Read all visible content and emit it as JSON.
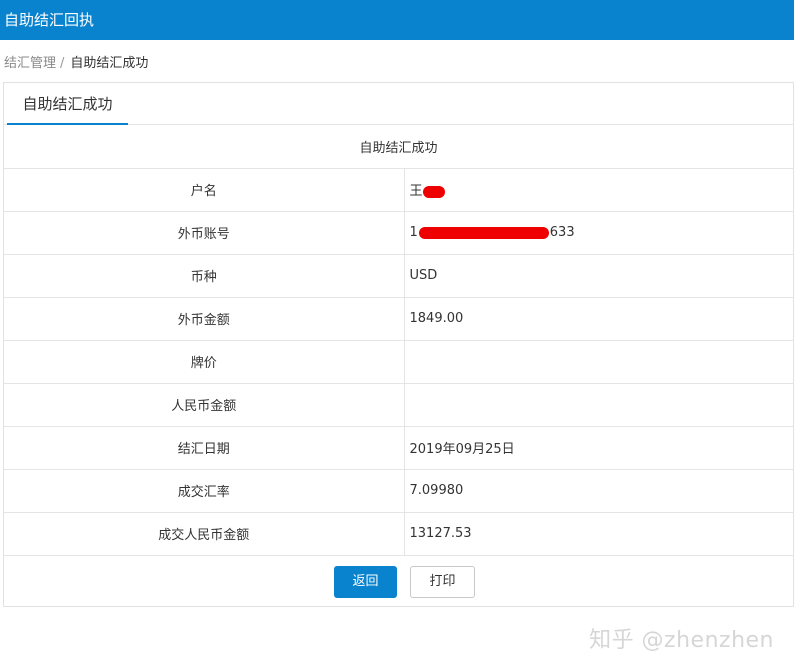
{
  "header": {
    "title": "自助结汇回执"
  },
  "breadcrumb": {
    "parent": "结汇管理",
    "separator": "/",
    "current": "自助结汇成功"
  },
  "tab": {
    "label": "自助结汇成功"
  },
  "table": {
    "caption": "自助结汇成功",
    "rows": [
      {
        "label": "户名",
        "value": "王"
      },
      {
        "label": "外币账号",
        "value_prefix": "1",
        "value_suffix": "633"
      },
      {
        "label": "币种",
        "value": "USD"
      },
      {
        "label": "外币金额",
        "value": "1849.00"
      },
      {
        "label": "牌价",
        "value": ""
      },
      {
        "label": "人民币金额",
        "value": ""
      },
      {
        "label": "结汇日期",
        "value": "2019年09月25日"
      },
      {
        "label": "成交汇率",
        "value": "7.09980"
      },
      {
        "label": "成交人民币金额",
        "value": "13127.53"
      }
    ]
  },
  "actions": {
    "back_label": "返回",
    "print_label": "打印"
  },
  "watermark": {
    "text": "知乎 @zhenzhen"
  },
  "colors": {
    "accent": "#0a83cf",
    "redaction": "#ee0000"
  }
}
